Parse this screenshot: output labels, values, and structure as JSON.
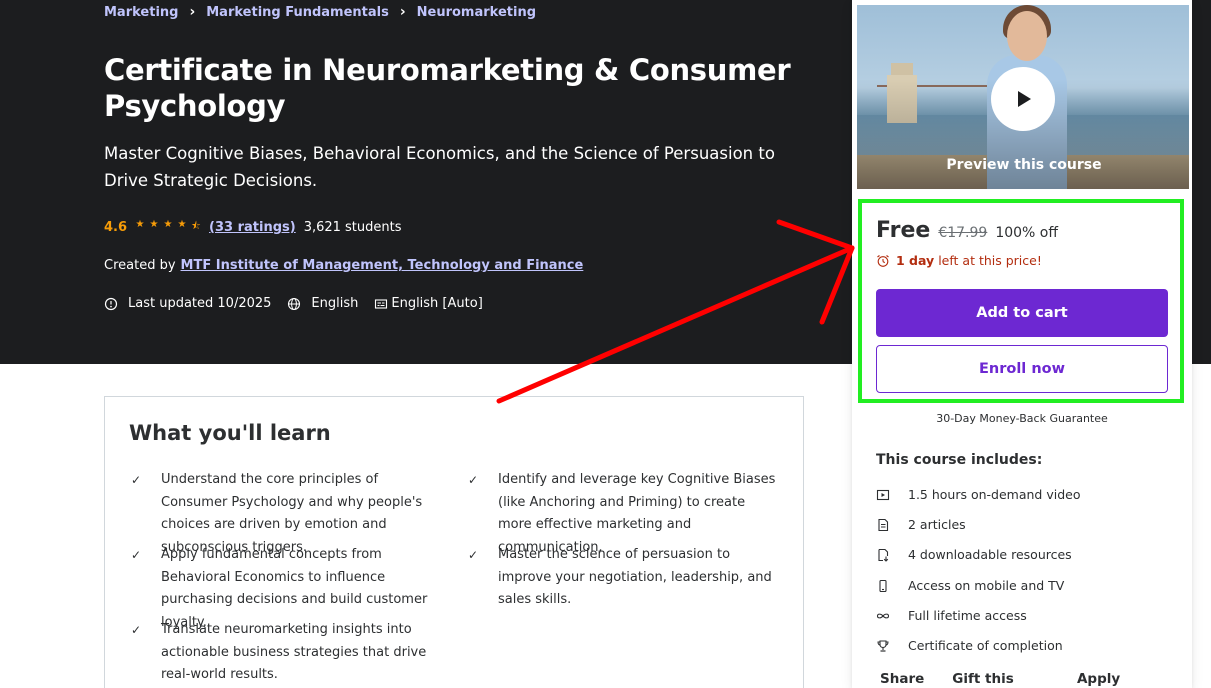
{
  "breadcrumb": [
    "Marketing",
    "Marketing Fundamentals",
    "Neuromarketing"
  ],
  "course": {
    "title": "Certificate in Neuromarketing & Consumer Psychology",
    "subtitle": "Master Cognitive Biases, Behavioral Economics, and the Science of Persuasion to Drive Strategic Decisions.",
    "rating": "4.6",
    "rating_stars": 4.5,
    "ratings_count": "(33 ratings)",
    "students": "3,621 students",
    "created_by_label": "Created by",
    "author": "MTF Institute of Management, Technology and Finance",
    "last_updated": "Last updated 10/2025",
    "language": "English",
    "captions": "English [Auto]"
  },
  "learn": {
    "title": "What you'll learn",
    "items": [
      "Understand the core principles of Consumer Psychology and why people's choices are driven by emotion and subconscious triggers.",
      "Identify and leverage key Cognitive Biases (like Anchoring and Priming) to create more effective marketing and communication.",
      "Apply fundamental concepts from Behavioral Economics to influence purchasing decisions and build customer loyalty.",
      "Master the science of persuasion to improve your negotiation, leadership, and sales skills.",
      "Translate neuromarketing insights into actionable business strategies that drive real-world results."
    ]
  },
  "sidebar": {
    "preview_label": "Preview this course",
    "price": "Free",
    "original_price": "€17.99",
    "discount": "100% off",
    "timer_bold": "1 day",
    "timer_rest": "left at this price!",
    "add_to_cart": "Add to cart",
    "enroll_now": "Enroll now",
    "guarantee": "30-Day Money-Back Guarantee",
    "includes_title": "This course includes:",
    "includes": [
      {
        "icon": "video-icon",
        "label": "1.5 hours on-demand video"
      },
      {
        "icon": "article-icon",
        "label": "2 articles"
      },
      {
        "icon": "download-icon",
        "label": "4 downloadable resources"
      },
      {
        "icon": "mobile-icon",
        "label": "Access on mobile and TV"
      },
      {
        "icon": "infinity-icon",
        "label": "Full lifetime access"
      },
      {
        "icon": "trophy-icon",
        "label": "Certificate of completion"
      }
    ],
    "footer_links": [
      "Share",
      "Gift this course",
      "Apply Coupon"
    ]
  },
  "colors": {
    "hero_bg": "#1c1d1f",
    "accent_purple": "#6d28d2",
    "link_lavender": "#c0c4fc",
    "star_orange": "#f69c08",
    "timer_red": "#b32d0f",
    "annotation_red": "#ff0000",
    "annotation_green": "#22ee22"
  }
}
